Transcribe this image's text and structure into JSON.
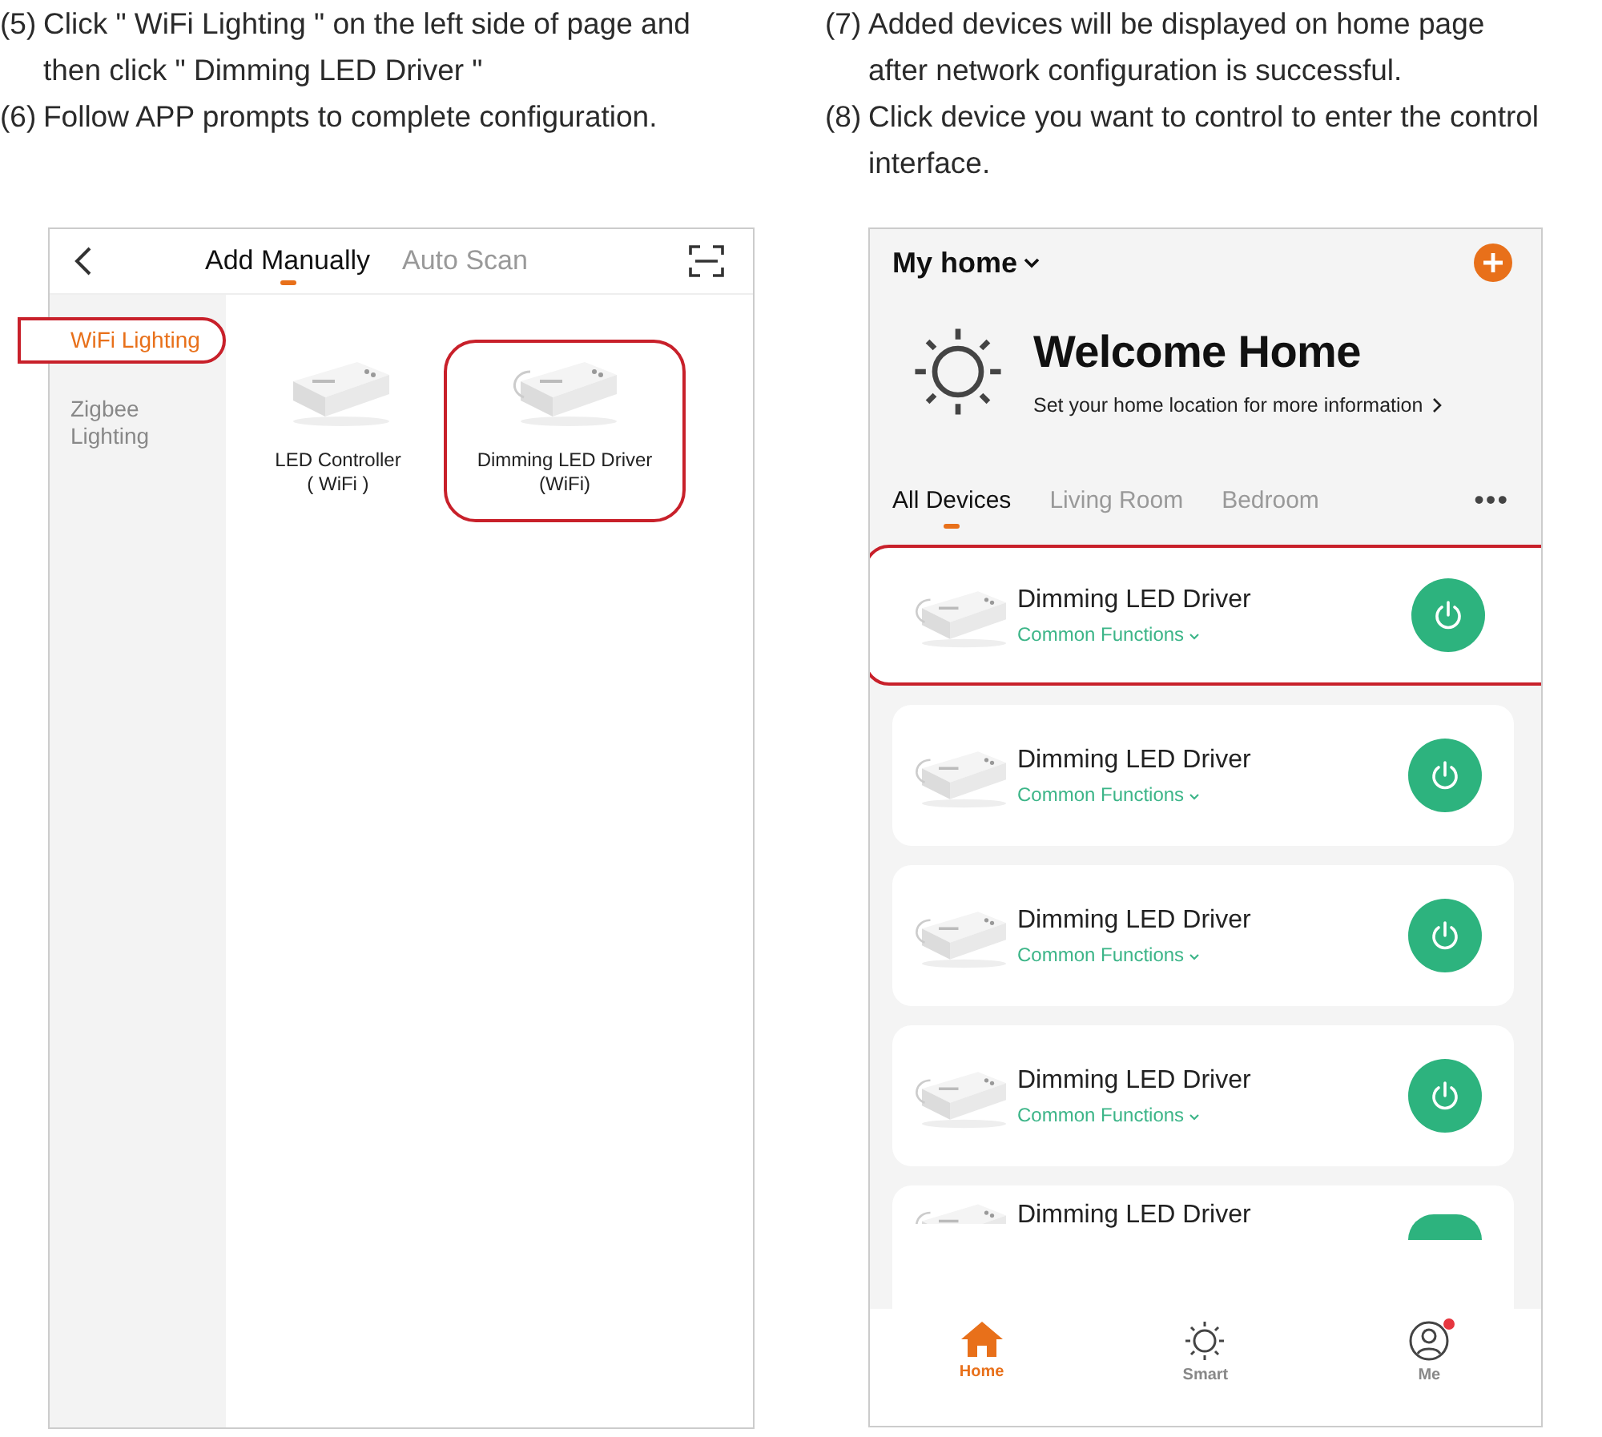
{
  "instructions": [
    {
      "number": "(5)",
      "lines": [
        "Click \" WiFi Lighting \" on the left side of page and",
        "then click \" Dimming LED Driver  \""
      ]
    },
    {
      "number": "(6)",
      "lines": [
        "Follow APP prompts to complete configuration."
      ]
    },
    {
      "number": "(7)",
      "lines": [
        "Added devices will be displayed on home page",
        "after network configuration is successful."
      ]
    },
    {
      "number": "(8)",
      "lines": [
        "Click device you want to control to enter the control",
        "interface."
      ]
    }
  ],
  "add_screen": {
    "tabs": [
      {
        "label": "Add Manually",
        "selected": true
      },
      {
        "label": "Auto Scan",
        "selected": false
      }
    ],
    "sidebar": {
      "items": [
        {
          "label": "WiFi Lighting",
          "selected": true,
          "highlighted": true
        },
        {
          "label": "Zigbee Lighting",
          "selected": false,
          "highlighted": false
        }
      ]
    },
    "products": [
      {
        "name": "LED Controller\n( WiFi )",
        "kind": "controller",
        "highlighted": false
      },
      {
        "name": "Dimming LED Driver\n(WiFi)",
        "kind": "driver",
        "highlighted": true
      }
    ]
  },
  "home_screen": {
    "home_name": "My home",
    "welcome": {
      "title": "Welcome Home",
      "subtitle": "Set your home location for more information"
    },
    "tabs": [
      {
        "label": "All Devices",
        "selected": true
      },
      {
        "label": "Living Room",
        "selected": false
      },
      {
        "label": "Bedroom",
        "selected": false
      }
    ],
    "more_label": "•••",
    "devices": [
      {
        "name": "Dimming LED Driver",
        "subtitle": "Common Functions",
        "highlighted": true
      },
      {
        "name": "Dimming LED Driver",
        "subtitle": "Common Functions",
        "highlighted": false
      },
      {
        "name": "Dimming LED Driver",
        "subtitle": "Common Functions",
        "highlighted": false
      },
      {
        "name": "Dimming LED Driver",
        "subtitle": "Common Functions",
        "highlighted": false
      },
      {
        "name": "Dimming LED Driver",
        "highlighted": false
      }
    ],
    "nav": [
      {
        "label": "Home",
        "kind": "home",
        "selected": true,
        "badge": false
      },
      {
        "label": "Smart",
        "kind": "smart",
        "selected": false,
        "badge": false
      },
      {
        "label": "Me",
        "kind": "me",
        "selected": false,
        "badge": true
      }
    ]
  }
}
